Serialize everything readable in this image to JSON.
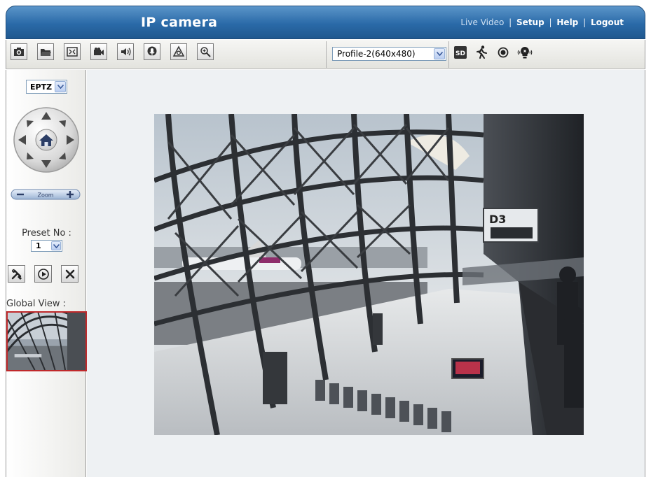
{
  "header": {
    "title": "IP camera",
    "nav": {
      "live_video": "Live Video",
      "setup": "Setup",
      "help": "Help",
      "logout": "Logout",
      "separator": "|"
    }
  },
  "toolbar": {
    "buttons": [
      "snapshot-icon",
      "folder-icon",
      "fullscreen-icon",
      "record-icon",
      "speaker-icon",
      "microphone-icon",
      "alarm-icon",
      "zoom-icon"
    ],
    "profile_value": "Profile-2(640x480)",
    "status_icons": [
      "sd-card-icon",
      "motion-icon",
      "recording-dot-icon",
      "light-bulb-icon"
    ]
  },
  "left_panel": {
    "mode_value": "EPTZ",
    "zoom_label": "Zoom",
    "preset_label": "Preset No :",
    "preset_value": "1",
    "global_view_label": "Global View :"
  },
  "colors": {
    "header_blue": "#2a6aa8",
    "panel_gray": "#ebebe8",
    "main_bg": "#eef1f3",
    "global_view_border": "#c0292b"
  }
}
